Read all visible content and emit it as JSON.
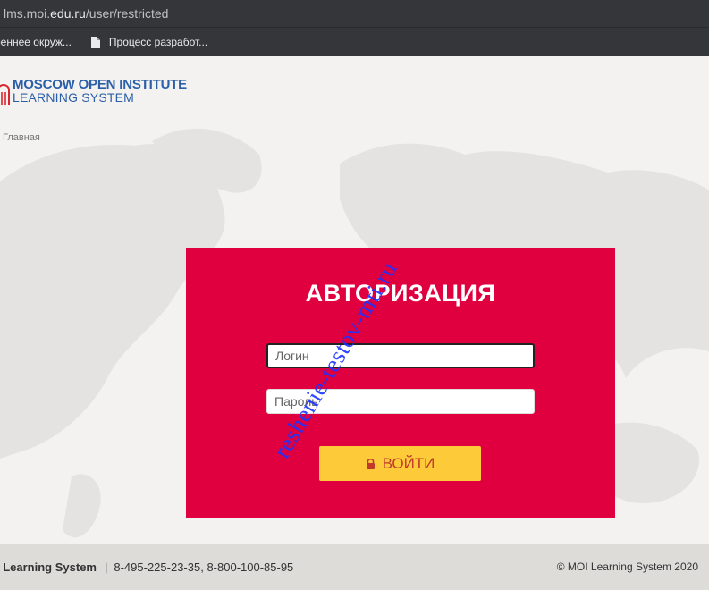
{
  "browser": {
    "url_prefix": "lms.moi.",
    "url_domain": "edu.ru",
    "url_path": "/user/restricted"
  },
  "bookmarks": [
    {
      "label": "реннее окруж..."
    },
    {
      "label": "Процесс разработ...",
      "icon": "document-icon"
    }
  ],
  "logo": {
    "line1": "MOSCOW OPEN INSTITUTE",
    "line2": "LEARNING SYSTEM"
  },
  "breadcrumb": "Главная",
  "auth": {
    "title": "АВТОРИЗАЦИЯ",
    "login_placeholder": "Логин",
    "password_placeholder": "Пароль",
    "submit_label": "ВОЙТИ"
  },
  "watermark": "reshenie-testov-mti.ru",
  "footer": {
    "brand": "I Learning System",
    "phones": "8-495-225-23-35, 8-800-100-85-95",
    "copyright": "© MOI Learning System 2020"
  },
  "colors": {
    "auth_bg": "#e0003f",
    "button_bg": "#fdcb3a",
    "logo_blue": "#2b5fa8",
    "watermark": "#1a33ff"
  }
}
